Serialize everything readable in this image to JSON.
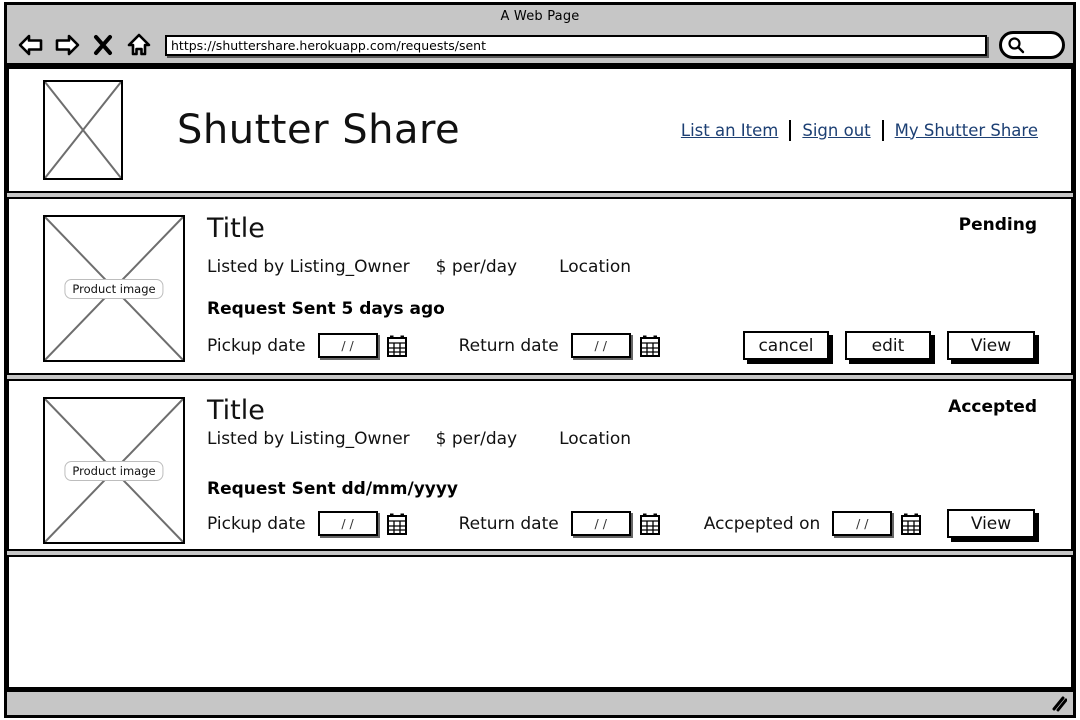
{
  "browser": {
    "title": "A Web Page",
    "url": "https://shuttershare.herokuapp.com/requests/sent",
    "back_icon": "back-arrow-icon",
    "forward_icon": "forward-arrow-icon",
    "stop_icon": "close-x-icon",
    "home_icon": "home-icon",
    "search_icon": "search-icon",
    "resize_icon": "resize-grip-icon"
  },
  "header": {
    "logo_alt": "logo-placeholder",
    "brand": "Shutter Share",
    "nav": [
      {
        "label": "List an Item"
      },
      {
        "label": "Sign out"
      },
      {
        "label": "My Shutter Share"
      }
    ]
  },
  "requests": [
    {
      "thumb_label": "Product image",
      "title": "Title",
      "status": "Pending",
      "owner": "Listed by Listing_Owner",
      "price": "$ per/day",
      "location": "Location",
      "request_sent": "Request Sent 5 days ago",
      "pickup_label": "Pickup date",
      "pickup_value": "/ /",
      "return_label": "Return date",
      "return_value": "/ /",
      "accepted_label": "",
      "accepted_value": "",
      "buttons": [
        {
          "label": "cancel"
        },
        {
          "label": "edit"
        },
        {
          "label": "View"
        }
      ]
    },
    {
      "thumb_label": "Product image",
      "title": "Title",
      "status": "Accepted",
      "owner": "Listed by Listing_Owner",
      "price": "$ per/day",
      "location": "Location",
      "request_sent": "Request Sent dd/mm/yyyy",
      "pickup_label": "Pickup date",
      "pickup_value": "/ /",
      "return_label": "Return date",
      "return_value": "/ /",
      "accepted_label": "Accpepted on",
      "accepted_value": "/ /",
      "buttons": [
        {
          "label": "View"
        }
      ]
    }
  ],
  "colors": {
    "link": "#1c3f73",
    "chrome": "#c6c6c6",
    "ink": "#000000",
    "paper": "#ffffff"
  }
}
